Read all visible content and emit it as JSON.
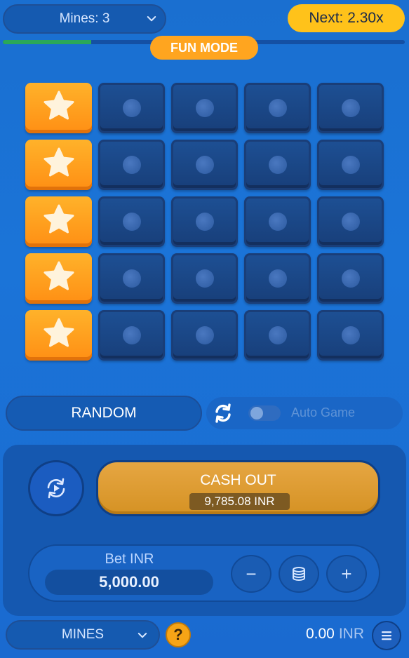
{
  "header": {
    "mines_select": "Mines: 3",
    "next_multiplier": "Next: 2.30x",
    "progress_fraction": 0.22,
    "mode_badge": "FUN MODE"
  },
  "board": {
    "columns": 5,
    "rows": 5,
    "tiles": [
      [
        "star",
        "hidden",
        "hidden",
        "hidden",
        "hidden"
      ],
      [
        "star",
        "hidden",
        "hidden",
        "hidden",
        "hidden"
      ],
      [
        "star",
        "hidden",
        "hidden",
        "hidden",
        "hidden"
      ],
      [
        "star",
        "hidden",
        "hidden",
        "hidden",
        "hidden"
      ],
      [
        "star",
        "hidden",
        "hidden",
        "hidden",
        "hidden"
      ]
    ],
    "icons": {
      "star": "star-icon",
      "hidden": "dot-icon"
    }
  },
  "controls": {
    "random_label": "RANDOM",
    "auto_game_label": "Auto Game",
    "auto_game_on": false,
    "cashout_label": "CASH OUT",
    "cashout_amount": "9,785.08 INR",
    "bet_label": "Bet INR",
    "bet_value": "5,000.00",
    "minus_label": "−",
    "plus_label": "+",
    "coins_icon": "coins-icon",
    "replay_icon": "replay-icon",
    "refresh_icon": "refresh-icon"
  },
  "footer": {
    "game_select": "MINES",
    "help_label": "?",
    "balance_value": "0.00",
    "balance_currency": "INR",
    "menu_icon": "menu-icon"
  },
  "colors": {
    "background": "#1a6fd0",
    "star_tile": "#ff9f1f",
    "hidden_tile": "#1d4f93",
    "next_pill": "#ffc21a",
    "fun_mode": "#ffa51f",
    "cashout": "#e0a03a",
    "progress": "#2aa85a"
  }
}
